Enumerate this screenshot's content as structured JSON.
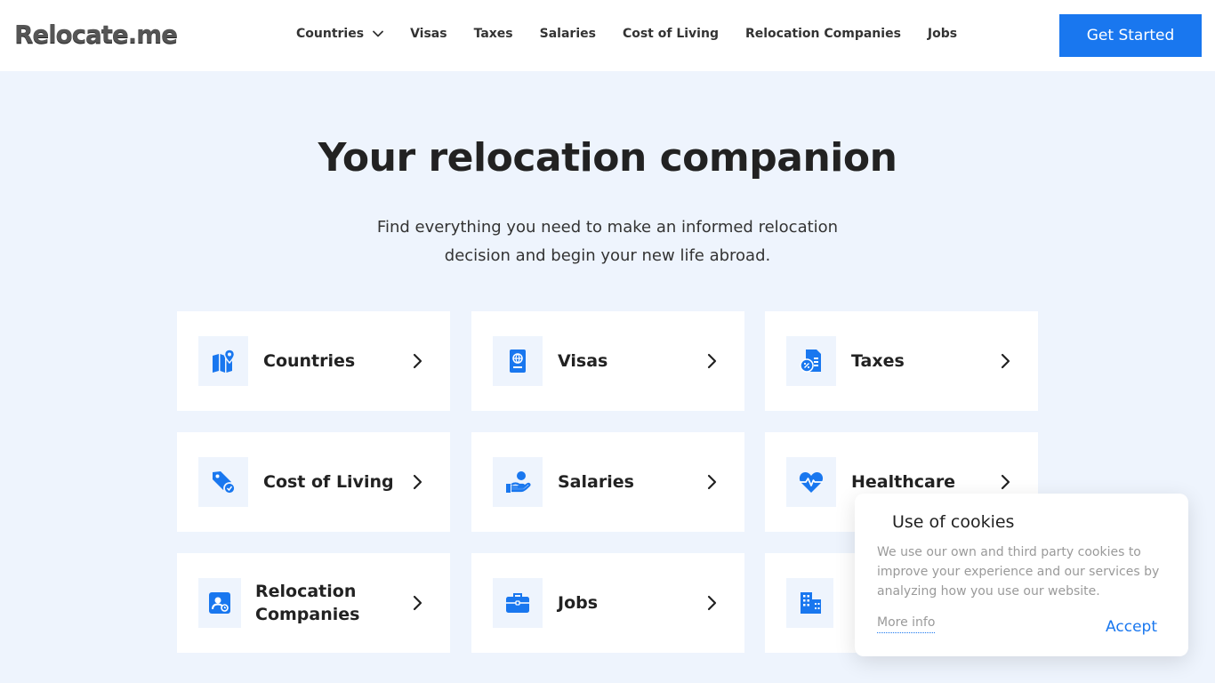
{
  "brand": {
    "logo_text": "Relocate.me",
    "accent": "#1977ef"
  },
  "nav": {
    "items": [
      {
        "label": "Countries",
        "has_dropdown": true
      },
      {
        "label": "Visas"
      },
      {
        "label": "Taxes"
      },
      {
        "label": "Salaries"
      },
      {
        "label": "Cost of Living"
      },
      {
        "label": "Relocation Companies"
      },
      {
        "label": "Jobs"
      }
    ],
    "cta_label": "Get Started"
  },
  "hero": {
    "title": "Your relocation companion",
    "subtitle_line1": "Find everything you need to make an informed relocation",
    "subtitle_line2": "decision and begin your new life abroad."
  },
  "cards": [
    {
      "label": "Countries",
      "icon": "map-pin-icon"
    },
    {
      "label": "Visas",
      "icon": "passport-icon"
    },
    {
      "label": "Taxes",
      "icon": "tax-document-icon"
    },
    {
      "label": "Cost of Living",
      "icon": "price-tag-icon"
    },
    {
      "label": "Salaries",
      "icon": "hand-money-icon"
    },
    {
      "label": "Healthcare",
      "icon": "heart-pulse-icon"
    },
    {
      "label": "Relocation Companies",
      "icon": "id-badge-icon"
    },
    {
      "label": "Jobs",
      "icon": "briefcase-icon"
    },
    {
      "label": "",
      "icon": "buildings-icon"
    }
  ],
  "cookie": {
    "title": "Use of cookies",
    "text": "We use our own and third party cookies to improve your experience and our services by analyzing how you use our website.",
    "more_label": "More info",
    "accept_label": "Accept"
  }
}
